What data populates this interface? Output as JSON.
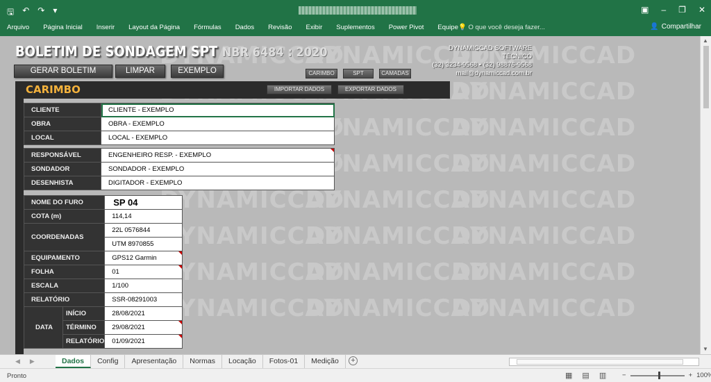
{
  "titlebar": {
    "save_icon": "save-icon",
    "undo_icon": "undo-icon",
    "redo_icon": "redo-icon",
    "window_controls": [
      "restore-ribbon-icon",
      "minimize-icon",
      "restore-icon",
      "close-icon"
    ]
  },
  "ribbon": {
    "tabs": [
      "Arquivo",
      "Página Inicial",
      "Inserir",
      "Layout da Página",
      "Fórmulas",
      "Dados",
      "Revisão",
      "Exibir",
      "Suplementos",
      "Power Pivot",
      "Equipe"
    ],
    "tell_me": "O que você deseja fazer...",
    "share": "Compartilhar",
    "accent": "#217346"
  },
  "header": {
    "title": "BOLETIM DE SONDAGEM SPT",
    "norm": "NBR 6484 : 2020",
    "buttons": {
      "generate": "GERAR BOLETIM",
      "clear": "LIMPAR",
      "example": "EXEMPLO"
    },
    "nav": {
      "stamp": "CARIMBO",
      "spt": "SPT",
      "layers": "CAMADAS"
    },
    "contact": {
      "company": "DYNAMICCAD SOFTWARE TÉCNICO",
      "phones": "(32) 3234-9568 • (32) 98876-9568",
      "email": "mail@dynamiccad.com.br"
    },
    "watermark": "DYNAMICCAD"
  },
  "panel": {
    "title": "CARIMBO",
    "import": "IMPORTAR DADOS",
    "export": "EXPORTAR DADOS",
    "title_color": "#f4b23c"
  },
  "group1": [
    {
      "label": "CLIENTE",
      "value": "CLIENTE - EXEMPLO"
    },
    {
      "label": "OBRA",
      "value": "OBRA - EXEMPLO"
    },
    {
      "label": "LOCAL",
      "value": "LOCAL - EXEMPLO"
    }
  ],
  "group2": [
    {
      "label": "RESPONSÁVEL",
      "value": "ENGENHEIRO RESP. - EXEMPLO"
    },
    {
      "label": "SONDADOR",
      "value": "SONDADOR - EXEMPLO"
    },
    {
      "label": "DESENHISTA",
      "value": "DIGITADOR - EXEMPLO"
    }
  ],
  "borehole": {
    "name_label": "NOME DO FURO",
    "name_value": "SP 04",
    "cota_label": "COTA (m)",
    "cota_value": "114,14",
    "coord_label": "COORDENADAS",
    "coord_1": "22L 0576844",
    "coord_2": "UTM 8970855",
    "equip_label": "EQUIPAMENTO",
    "equip_value": "GPS12 Garmin",
    "sheet_label": "FOLHA",
    "sheet_value": "01",
    "scale_label": "ESCALA",
    "scale_value": "1/100",
    "report_label": "RELATÓRIO",
    "report_value": "SSR-08291003",
    "date_label": "DATA",
    "start_label": "INÍCIO",
    "start_value": "28/08/2021",
    "end_label": "TÉRMINO",
    "end_value": "29/08/2021",
    "report_date_label": "RELATÓRIO",
    "report_date_value": "01/09/2021"
  },
  "sheet_tabs": [
    "Dados",
    "Config",
    "Apresentação",
    "Normas",
    "Locação",
    "Fotos-01",
    "Medição"
  ],
  "active_sheet": "Dados",
  "status": {
    "ready": "Pronto",
    "zoom": "100%"
  }
}
